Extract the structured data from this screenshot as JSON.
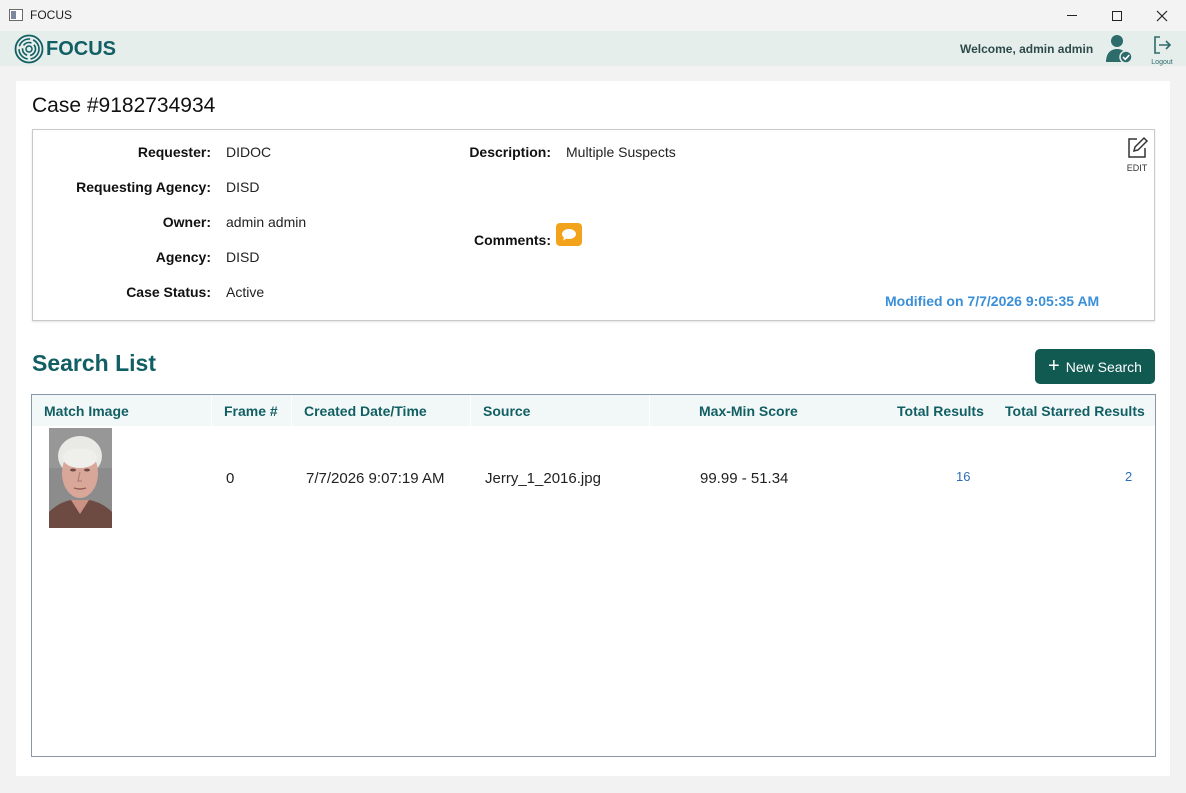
{
  "window": {
    "title": "FOCUS",
    "controls": {
      "minimize": "minimize",
      "maximize": "maximize",
      "close": "close"
    }
  },
  "header": {
    "logo_text": "FOCUS",
    "welcome": "Welcome, admin admin",
    "logout_label": "Logout",
    "brand_color": "#125f63"
  },
  "case": {
    "title": "Case #9182734934",
    "fields": {
      "requester": {
        "label": "Requester:",
        "value": "DIDOC"
      },
      "requesting_agency": {
        "label": "Requesting Agency:",
        "value": "DISD"
      },
      "owner": {
        "label": "Owner:",
        "value": "admin admin"
      },
      "agency": {
        "label": "Agency:",
        "value": "DISD"
      },
      "case_status": {
        "label": "Case Status:",
        "value": "Active"
      },
      "description": {
        "label": "Description:",
        "value": "Multiple Suspects"
      },
      "comments": {
        "label": "Comments:",
        "icon": "comment-icon",
        "icon_color": "#f3a21b"
      }
    },
    "edit_label": "EDIT",
    "modified": "Modified on 7/7/2026 9:05:35 AM"
  },
  "search_list": {
    "title": "Search List",
    "new_search_label": "New Search",
    "columns": [
      "Match Image",
      "Frame #",
      "Created Date/Time",
      "Source",
      "Max-Min Score",
      "Total Results",
      "Total Starred Results"
    ],
    "rows": [
      {
        "match_image": "face-photo",
        "frame": "0",
        "created": "7/7/2026 9:07:19 AM",
        "source": "Jerry_1_2016.jpg",
        "score": "99.99 - 51.34",
        "total_results": "16",
        "total_starred": "2"
      }
    ]
  }
}
